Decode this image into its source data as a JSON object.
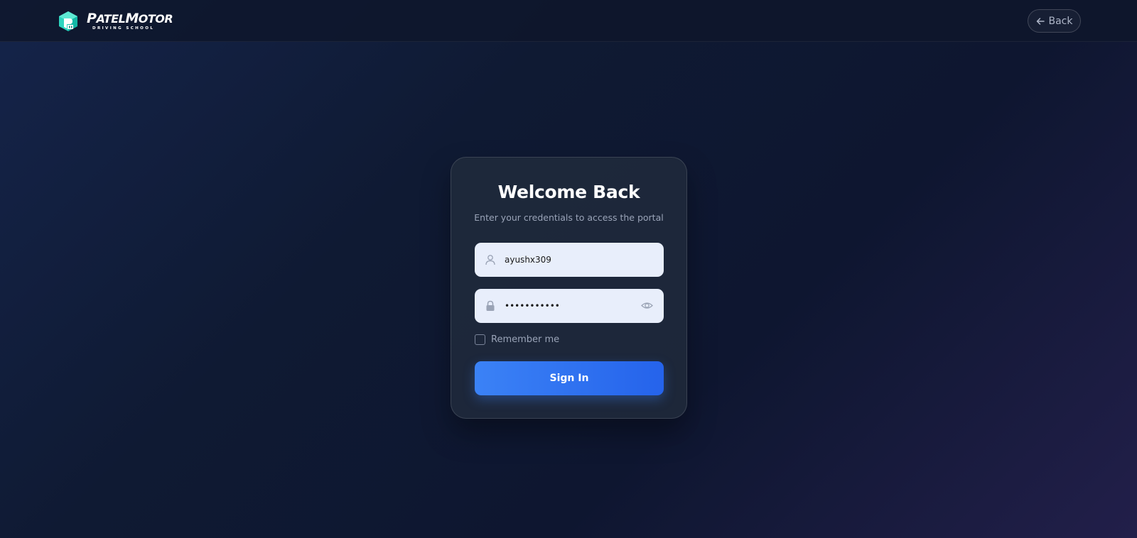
{
  "header": {
    "logo": {
      "brand_top_first": "P",
      "brand_top_rest": "ATEL",
      "brand_top_second_first": "M",
      "brand_top_second_rest": "OTOR",
      "brand_bottom": "DRIVING SCHOOL",
      "accent_color": "#2dd4bf"
    },
    "back_label": "Back"
  },
  "login": {
    "title": "Welcome Back",
    "subtitle": "Enter your credentials to access the portal",
    "username": {
      "value": "ayushx309",
      "icon": "user-icon"
    },
    "password": {
      "value": "•••••••••••",
      "icon": "lock-icon",
      "toggle_icon": "eye-icon"
    },
    "remember_label": "Remember me",
    "remember_checked": false,
    "signin_label": "Sign In",
    "button_color": "#3b82f6"
  }
}
